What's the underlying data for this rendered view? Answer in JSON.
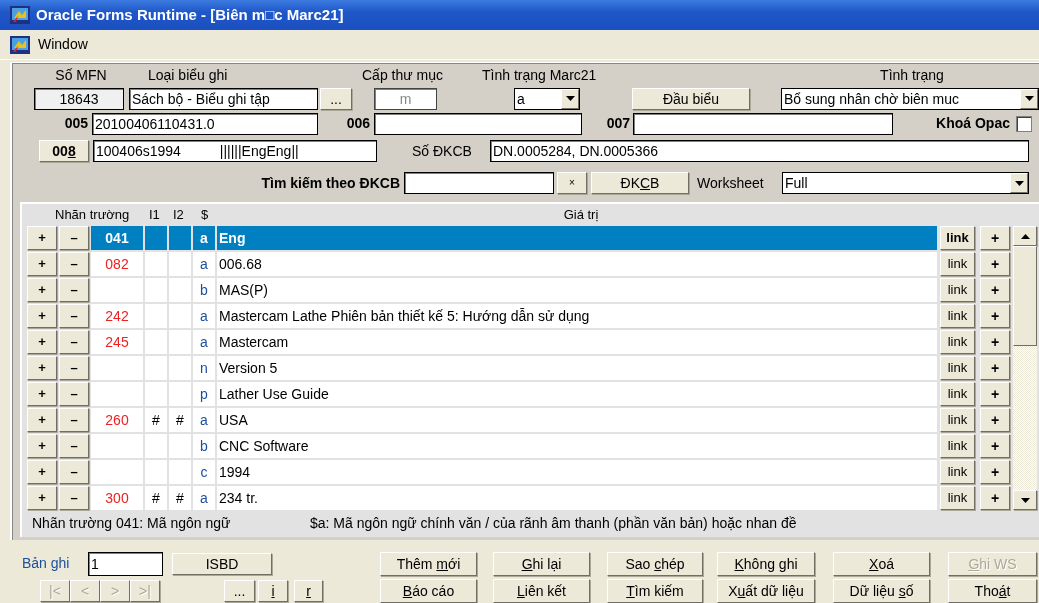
{
  "window": {
    "title": "Oracle Forms Runtime - [Biên m□c Marc21]"
  },
  "menu": [
    {
      "label": "Window"
    }
  ],
  "record": {
    "mfn_label": "Số MFN",
    "mfn": "18643",
    "type_label": "Loại biểu ghi",
    "type": "Sách bộ - Biểu ghi tập",
    "type_button": "...",
    "level_label": "Cấp thư mục",
    "level": "m",
    "marc_status_label": "Tình trạng Marc21",
    "marc_status": "a",
    "leader_button": "Đầu biểu",
    "status_label": "Tình trạng",
    "status": "Bổ sung nhân chờ biên muc",
    "f005_label": "005",
    "f005": "20100406110431.0",
    "f006_label": "006",
    "f007_label": "007",
    "opac_lock_label": "Khoá Opac",
    "opac_lock": false,
    "f008_button": {
      "pre": "00",
      "key": "8"
    },
    "f008": "100406s1994          ||||||EngEng||",
    "barcode_label": "Số ĐKCB",
    "barcodes": "DN.0005284, DN.0005366",
    "search_label": "Tìm kiếm theo ĐKCB",
    "clear_button": "×",
    "barcode_button": {
      "pre": "ĐK",
      "key": "C",
      "post": "B"
    },
    "worksheet_label": "Worksheet",
    "worksheet": "Full"
  },
  "table": {
    "columns": [
      "Nhãn trường",
      "I1",
      "I2",
      "$",
      "Giá trị"
    ],
    "rows": [
      {
        "add": "+",
        "remove": "–",
        "tag": "041",
        "code": "a",
        "value": "Eng",
        "link": "link",
        "insert": "+",
        "selected": true
      },
      {
        "add": "+",
        "remove": "–",
        "tag": "082",
        "code": "a",
        "value": "006.68",
        "link": "link",
        "insert": "+",
        "selected": false
      },
      {
        "add": "+",
        "remove": "–",
        "code": "b",
        "value": "MAS(P)",
        "link": "link",
        "insert": "+",
        "selected": false
      },
      {
        "add": "+",
        "remove": "–",
        "tag": "242",
        "code": "a",
        "value": "Mastercam Lathe Phiên bản thiết kế 5: Hướng dẫn sử dụng",
        "link": "link",
        "insert": "+",
        "selected": false
      },
      {
        "add": "+",
        "remove": "–",
        "tag": "245",
        "code": "a",
        "value": "Mastercam",
        "link": "link",
        "insert": "+",
        "selected": false
      },
      {
        "add": "+",
        "remove": "–",
        "code": "n",
        "value": "Version 5",
        "link": "link",
        "insert": "+",
        "selected": false
      },
      {
        "add": "+",
        "remove": "–",
        "code": "p",
        "value": "Lather Use Guide",
        "link": "link",
        "insert": "+",
        "selected": false
      },
      {
        "add": "+",
        "remove": "–",
        "tag": "260",
        "i1": "#",
        "i2": "#",
        "code": "a",
        "value": "USA",
        "link": "link",
        "insert": "+",
        "selected": false
      },
      {
        "add": "+",
        "remove": "–",
        "code": "b",
        "value": "CNC Software",
        "link": "link",
        "insert": "+",
        "selected": false
      },
      {
        "add": "+",
        "remove": "–",
        "code": "c",
        "value": "1994",
        "link": "link",
        "insert": "+",
        "selected": false
      },
      {
        "add": "+",
        "remove": "–",
        "tag": "300",
        "i1": "#",
        "i2": "#",
        "code": "a",
        "value": "234 tr.",
        "link": "link",
        "insert": "+",
        "selected": false
      }
    ]
  },
  "status_bar": {
    "field_hint": "Nhãn trường 041: Mã ngôn ngữ",
    "subfield_hint": "$a: Mã ngôn ngữ chính văn / của rãnh âm thanh (phần văn bản) hoặc nhan đề"
  },
  "footer": {
    "record_label": "Bản ghi",
    "record": "1",
    "isbd_button": "ISBD",
    "nav_buttons": [
      {
        "label": "|<",
        "disabled": true
      },
      {
        "label": "<",
        "disabled": true
      },
      {
        "label": ">",
        "disabled": true
      },
      {
        "label": ">|",
        "disabled": true
      }
    ],
    "small_buttons": [
      {
        "label": "...",
        "disabled": false
      },
      {
        "label": {
          "key": "i"
        },
        "disabled": false
      },
      {
        "label": {
          "key": "r"
        },
        "disabled": false
      }
    ],
    "actions": [
      {
        "label": {
          "pre": "Thêm ",
          "key": "m",
          "post": "ới"
        },
        "disabled": false
      },
      {
        "label": {
          "key": "G",
          "post": "hi lại"
        },
        "disabled": false
      },
      {
        "label": {
          "pre": "Sao ",
          "key": "c",
          "post": "hép"
        },
        "disabled": false
      },
      {
        "label": {
          "key": "K",
          "post": "hông ghi"
        },
        "disabled": false
      },
      {
        "label": {
          "key": "X",
          "post": "oá"
        },
        "disabled": false
      },
      {
        "label": {
          "key": "G",
          "post": "hi WS"
        },
        "disabled": true
      },
      {
        "label": {
          "key": "B",
          "post": "áo cáo"
        },
        "disabled": false
      },
      {
        "label": {
          "key": "L",
          "post": "iên kết"
        },
        "disabled": false
      },
      {
        "label": {
          "key": "T",
          "post": "ìm kiếm"
        },
        "disabled": false
      },
      {
        "label": {
          "pre": "X",
          "key": "u",
          "post": "ất dữ liệu"
        },
        "disabled": false
      },
      {
        "label": {
          "pre": "Dữ liệu ",
          "key": "s",
          "post": "ố"
        },
        "disabled": false
      },
      {
        "label": {
          "pre": "Tho",
          "key": "á",
          "post": "t"
        },
        "disabled": false
      }
    ]
  }
}
